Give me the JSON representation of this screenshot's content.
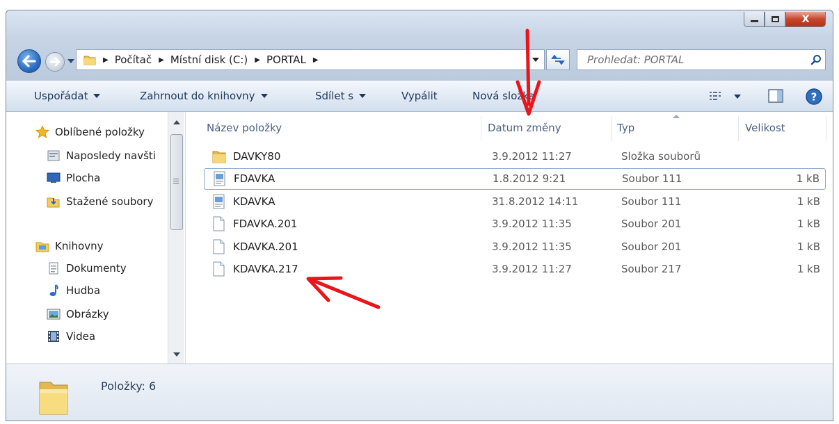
{
  "window": {
    "close_label": "X"
  },
  "address": {
    "crumbs": [
      "Počítač",
      "Místní disk (C:)",
      "PORTAL"
    ]
  },
  "search": {
    "placeholder": "Prohledat: PORTAL"
  },
  "toolbar": {
    "organize": "Uspořádat",
    "include_library": "Zahrnout do knihovny",
    "share": "Sdílet s",
    "burn": "Vypálit",
    "new_folder": "Nová složka"
  },
  "sidebar": {
    "favorites": {
      "label": "Oblíbené položky",
      "items": [
        "Naposledy navšti",
        "Plocha",
        "Stažené soubory"
      ]
    },
    "libraries": {
      "label": "Knihovny",
      "items": [
        "Dokumenty",
        "Hudba",
        "Obrázky",
        "Videa"
      ]
    }
  },
  "columns": {
    "name": "Název položky",
    "date": "Datum změny",
    "type": "Typ",
    "size": "Velikost"
  },
  "files": [
    {
      "name": "DAVKY80",
      "date": "3.9.2012 11:27",
      "type": "Složka souborů",
      "size": "",
      "icon": "folder-icon"
    },
    {
      "name": "FDAVKA",
      "date": "1.8.2012 9:21",
      "type": "Soubor 111",
      "size": "1 kB",
      "icon": "document-icon",
      "selected": true
    },
    {
      "name": "KDAVKA",
      "date": "31.8.2012 14:11",
      "type": "Soubor 111",
      "size": "1 kB",
      "icon": "document-icon"
    },
    {
      "name": "FDAVKA.201",
      "date": "3.9.2012 11:35",
      "type": "Soubor 201",
      "size": "1 kB",
      "icon": "blank-file-icon"
    },
    {
      "name": "KDAVKA.201",
      "date": "3.9.2012 11:35",
      "type": "Soubor 201",
      "size": "1 kB",
      "icon": "blank-file-icon"
    },
    {
      "name": "KDAVKA.217",
      "date": "3.9.2012 11:27",
      "type": "Soubor 217",
      "size": "1 kB",
      "icon": "blank-file-icon"
    }
  ],
  "details": {
    "count": "Položky: 6"
  },
  "colors": {
    "accent": "#1e395b",
    "annotation_arrow": "#e8161b",
    "selection_border": "#8aa9d1"
  }
}
